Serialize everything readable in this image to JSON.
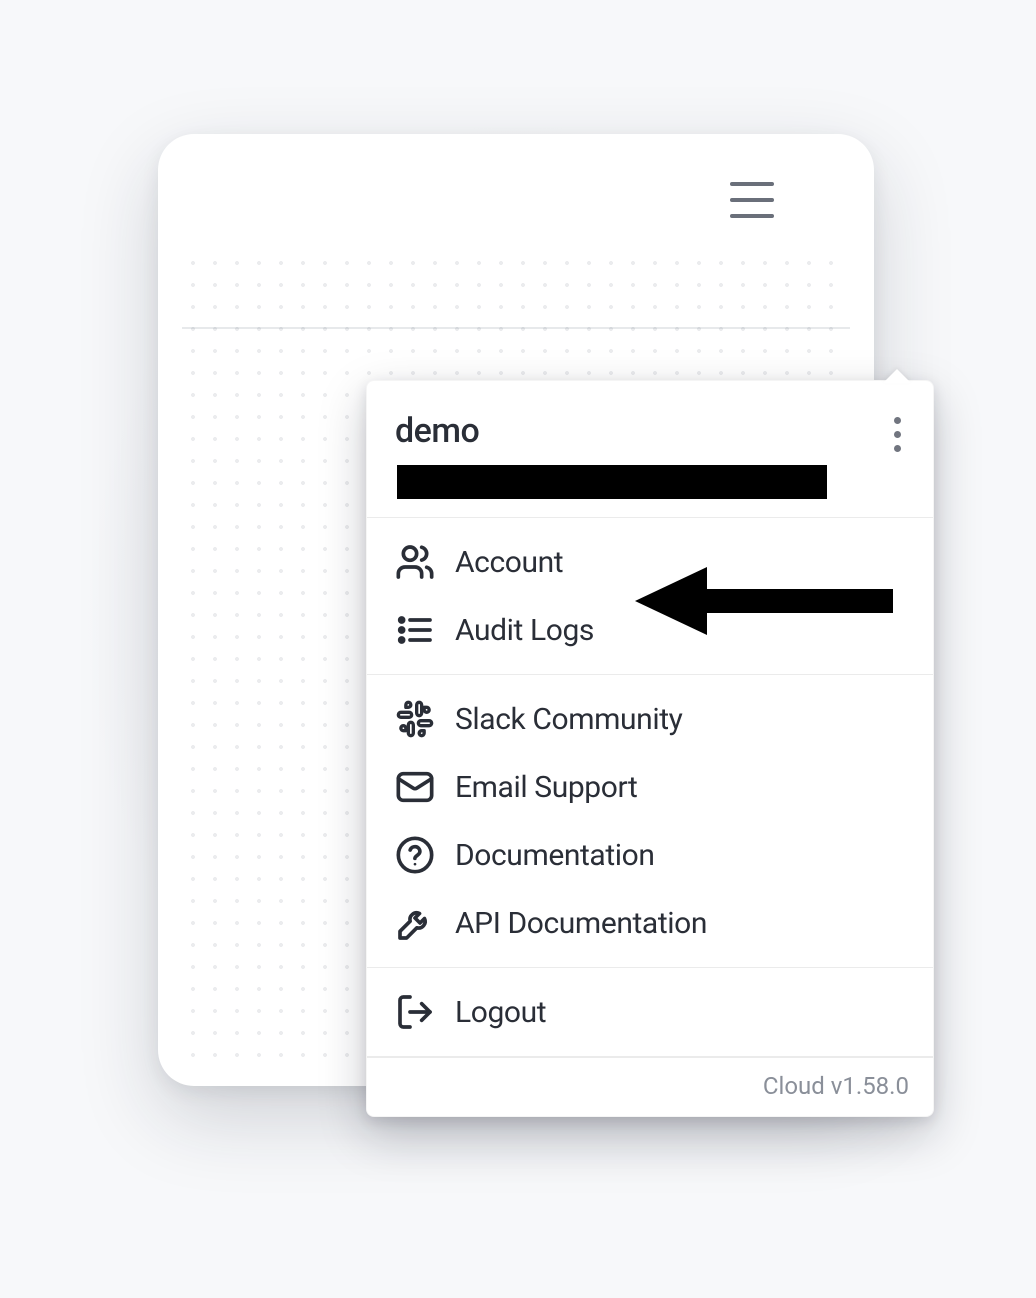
{
  "header": {
    "workspace_name": "demo"
  },
  "menu": {
    "section_a": [
      {
        "icon": "users-icon",
        "label": "Account"
      },
      {
        "icon": "list-icon",
        "label": "Audit Logs"
      }
    ],
    "section_b": [
      {
        "icon": "slack-icon",
        "label": "Slack Community"
      },
      {
        "icon": "mail-icon",
        "label": "Email Support"
      },
      {
        "icon": "help-icon",
        "label": "Documentation"
      },
      {
        "icon": "wrench-icon",
        "label": "API Documentation"
      }
    ],
    "section_c": [
      {
        "icon": "logout-icon",
        "label": "Logout"
      }
    ]
  },
  "footer": {
    "version_label": "Cloud v1.58.0"
  }
}
